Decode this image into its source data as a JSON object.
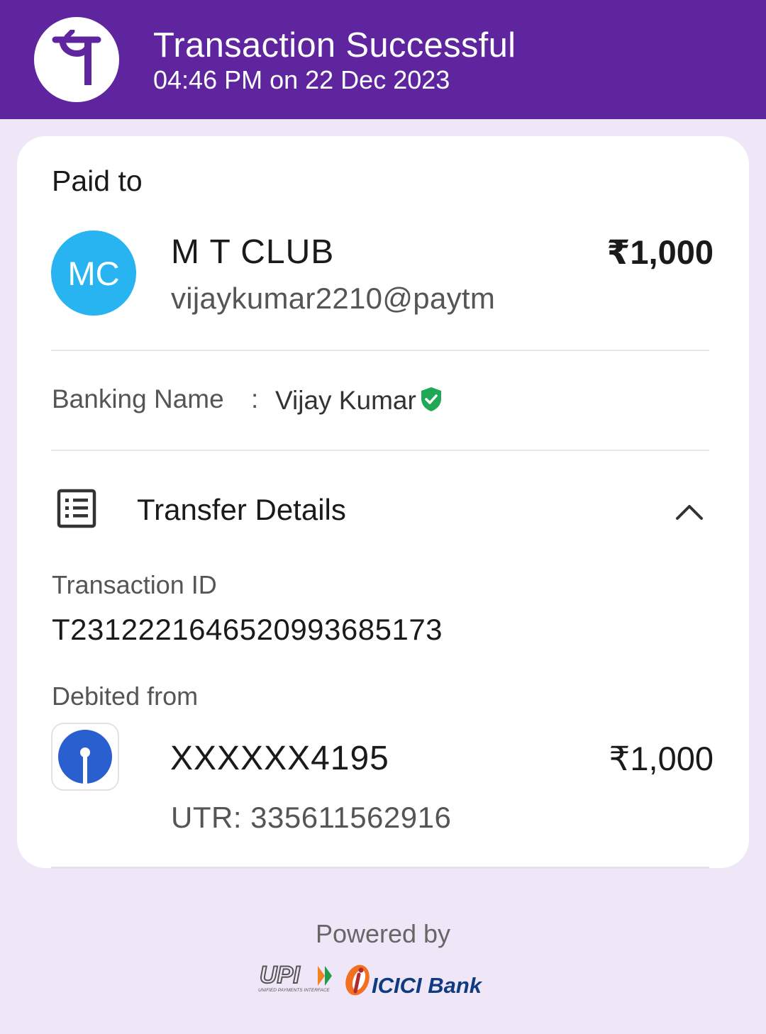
{
  "header": {
    "title": "Transaction Successful",
    "subtitle": "04:46 PM on 22 Dec 2023",
    "logo_icon": "phonepe-logo-icon",
    "background": "#5f259f"
  },
  "paid_to": {
    "label": "Paid to",
    "avatar_initials": "MC",
    "avatar_color": "#27b4f0",
    "name": "M T CLUB",
    "upi_id": "vijaykumar2210@paytm",
    "amount": "₹1,000"
  },
  "banking_name": {
    "label": "Banking Name",
    "separator": ":",
    "value": "Vijay Kumar",
    "verified_icon": "verified-shield-icon"
  },
  "transfer_details": {
    "title": "Transfer Details",
    "icon": "list-details-icon",
    "toggle_icon": "chevron-up-icon",
    "transaction_id_label": "Transaction ID",
    "transaction_id": "T2312221646520993685173",
    "debited_from_label": "Debited from",
    "bank_icon": "sbi-bank-icon",
    "account": "XXXXXX4195",
    "amount": "₹1,000",
    "utr": "UTR: 335611562916"
  },
  "footer": {
    "powered_by": "Powered by",
    "upi_logo_text": "UPI",
    "upi_logo_subtext": "UNIFIED PAYMENTS INTERFACE",
    "partner_logo_text": "ICICI Bank"
  }
}
